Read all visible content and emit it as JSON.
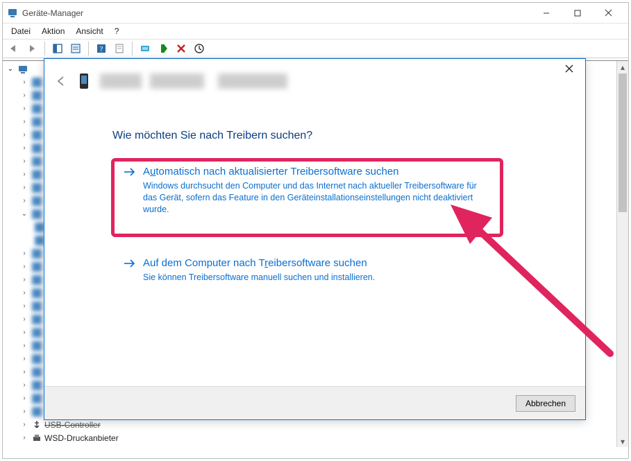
{
  "window": {
    "title": "Geräte-Manager"
  },
  "menubar": {
    "file": "Datei",
    "action": "Aktion",
    "view": "Ansicht",
    "help": "?"
  },
  "tree": {
    "last_visible_1": "USB-Controller",
    "last_visible_2": "WSD-Druckanbieter"
  },
  "dialog": {
    "question": "Wie möchten Sie nach Treibern suchen?",
    "option1": {
      "title_pre": "A",
      "title_u": "u",
      "title_post": "tomatisch nach aktualisierter Treibersoftware suchen",
      "desc": "Windows durchsucht den Computer und das Internet nach aktueller Treibersoftware für das Gerät, sofern das Feature in den Geräteinstallationseinstellungen nicht deaktiviert wurde."
    },
    "option2": {
      "title_pre": "Auf dem Computer nach T",
      "title_u": "r",
      "title_post": "eibersoftware suchen",
      "desc": "Sie können Treibersoftware manuell suchen und installieren."
    },
    "cancel": "Abbrechen"
  }
}
